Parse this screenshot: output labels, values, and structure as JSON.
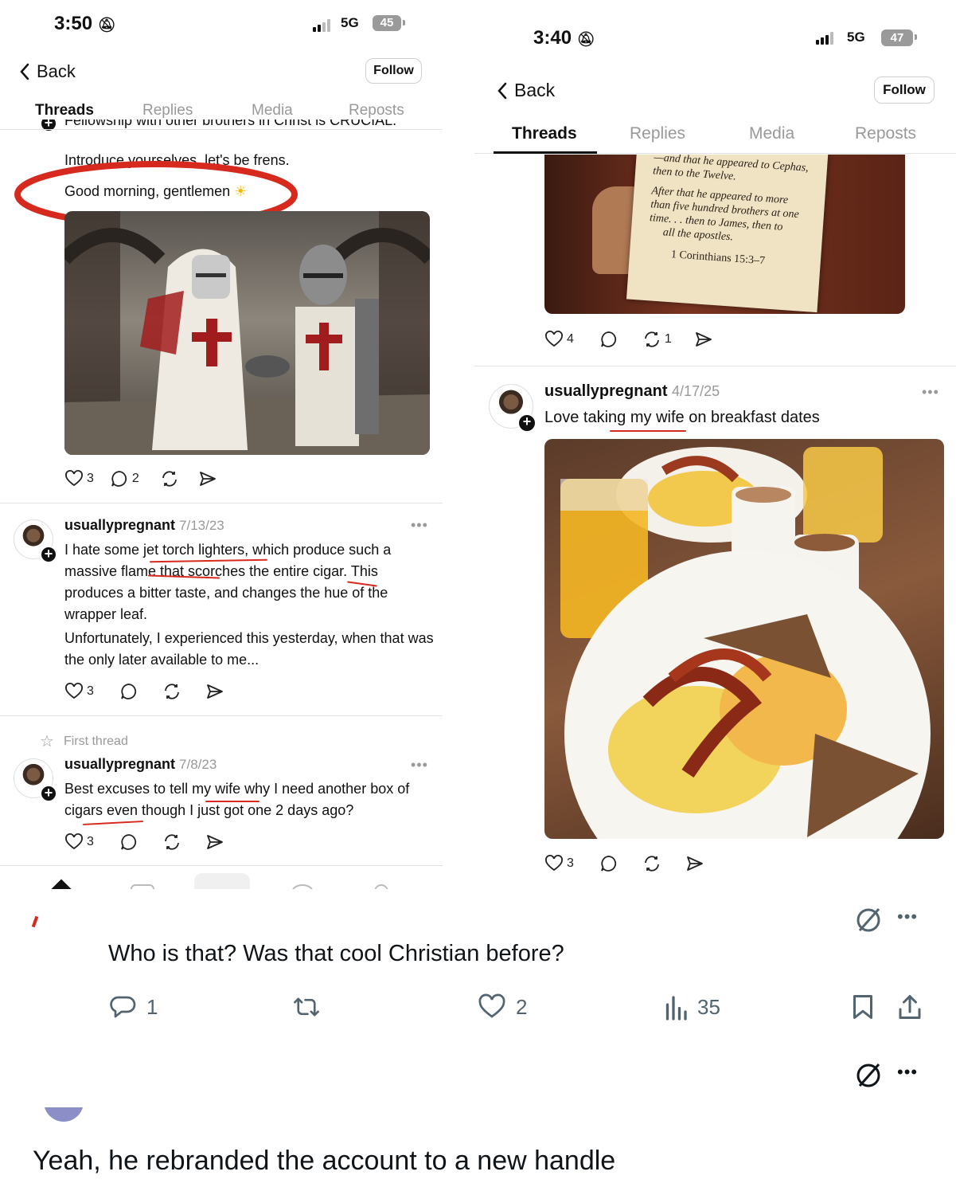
{
  "left": {
    "status": {
      "time": "3:50",
      "network": "5G",
      "battery": "45"
    },
    "nav": {
      "back": "Back",
      "follow": "Follow"
    },
    "tabs": [
      "Threads",
      "Replies",
      "Media",
      "Reposts"
    ],
    "post1": {
      "clipped_line": "Fellowship with other brothers in Christ is CRUCIAL.",
      "line1": "Introduce yourselves, let's be frens.",
      "line2": "Good morning, gentlemen",
      "likes": "3",
      "replies": "2"
    },
    "post2": {
      "username": "usuallypregnant",
      "date": "7/13/23",
      "p1": "I hate some jet torch lighters, which produce such a massive flame that scorches the entire cigar. This produces a bitter taste, and changes the hue of the wrapper leaf.",
      "p2": "Unfortunately, I experienced this yesterday, when that was the only later available to me...",
      "likes": "3"
    },
    "post3": {
      "pinned": "First thread",
      "username": "usuallypregnant",
      "date": "7/8/23",
      "text": "Best excuses to tell my wife why I need another box of cigars even though I just got one 2 days ago?",
      "likes": "3"
    }
  },
  "right": {
    "status": {
      "time": "3:40",
      "network": "5G",
      "battery": "47"
    },
    "nav": {
      "back": "Back",
      "follow": "Follow"
    },
    "tabs": [
      "Threads",
      "Replies",
      "Media",
      "Reposts"
    ],
    "scroll_text": {
      "l1": "—and that he appeared to Cephas,",
      "l2": "then to the Twelve.",
      "l3": "After that he appeared to more",
      "l4": "than five hundred brothers at one",
      "l5": "time. . . then to James, then to",
      "l6": "all the apostles.",
      "ref": "1 Corinthians 15:3–7"
    },
    "post1": {
      "likes": "4",
      "reposts": "1"
    },
    "post2": {
      "username": "usuallypregnant",
      "date": "4/17/25",
      "text": "Love taking my wife on breakfast dates",
      "likes": "3"
    }
  },
  "tweet1": {
    "text": "Who is that? Was that cool Christian before?",
    "replies": "1",
    "likes": "2",
    "views": "35"
  },
  "tweet2": {
    "text": "Yeah, he rebranded the account to a new handle"
  },
  "colors": {
    "annotation_red": "#d72a1f",
    "muted": "#999999"
  }
}
